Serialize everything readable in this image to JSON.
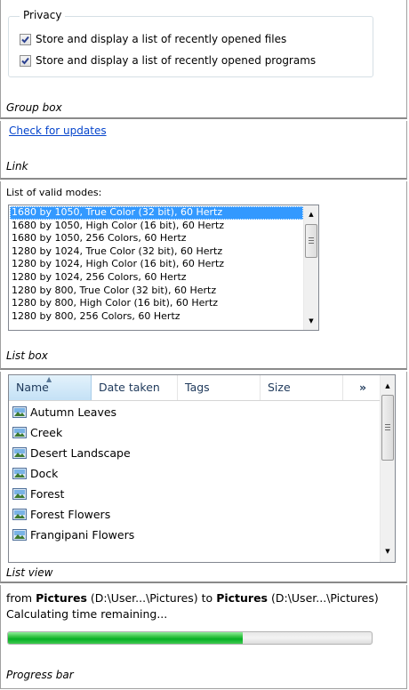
{
  "group_box": {
    "legend": "Privacy",
    "checkboxes": [
      {
        "label": "Store and display a list of recently opened files",
        "checked": true
      },
      {
        "label": "Store and display a list of recently opened programs",
        "checked": true
      }
    ],
    "caption": "Group box"
  },
  "link_section": {
    "link_text": "Check for updates",
    "caption": "Link"
  },
  "listbox_section": {
    "label": "List of valid modes:",
    "items": [
      "1680 by 1050, True Color (32 bit), 60 Hertz",
      "1680 by 1050, High Color (16 bit), 60 Hertz",
      "1680 by 1050, 256 Colors, 60 Hertz",
      "1280 by 1024, True Color (32 bit), 60 Hertz",
      "1280 by 1024, High Color (16 bit), 60 Hertz",
      "1280 by 1024, 256 Colors, 60 Hertz",
      "1280 by 800, True Color (32 bit), 60 Hertz",
      "1280 by 800, High Color (16 bit), 60 Hertz",
      "1280 by 800, 256 Colors, 60 Hertz"
    ],
    "selected_index": 0,
    "caption": "List box"
  },
  "listview_section": {
    "columns": [
      "Name",
      "Date taken",
      "Tags",
      "Size",
      "»"
    ],
    "sorted_column": "Name",
    "rows": [
      "Autumn Leaves",
      "Creek",
      "Desert Landscape",
      "Dock",
      "Forest",
      "Forest Flowers",
      "Frangipani Flowers"
    ],
    "caption": "List view"
  },
  "progress_section": {
    "line1": {
      "from_word": "from",
      "from_name": "Pictures",
      "from_path": "(D:\\User...\\Pictures)",
      "to_word": "to",
      "to_name": "Pictures",
      "to_path": "(D:\\User...\\Pictures)"
    },
    "line2": "Calculating time remaining...",
    "progress_fraction": 0.645,
    "caption": "Progress bar"
  },
  "colors": {
    "selection": "#3399ff",
    "link": "#0645cc",
    "progress_green": "#06b025"
  }
}
